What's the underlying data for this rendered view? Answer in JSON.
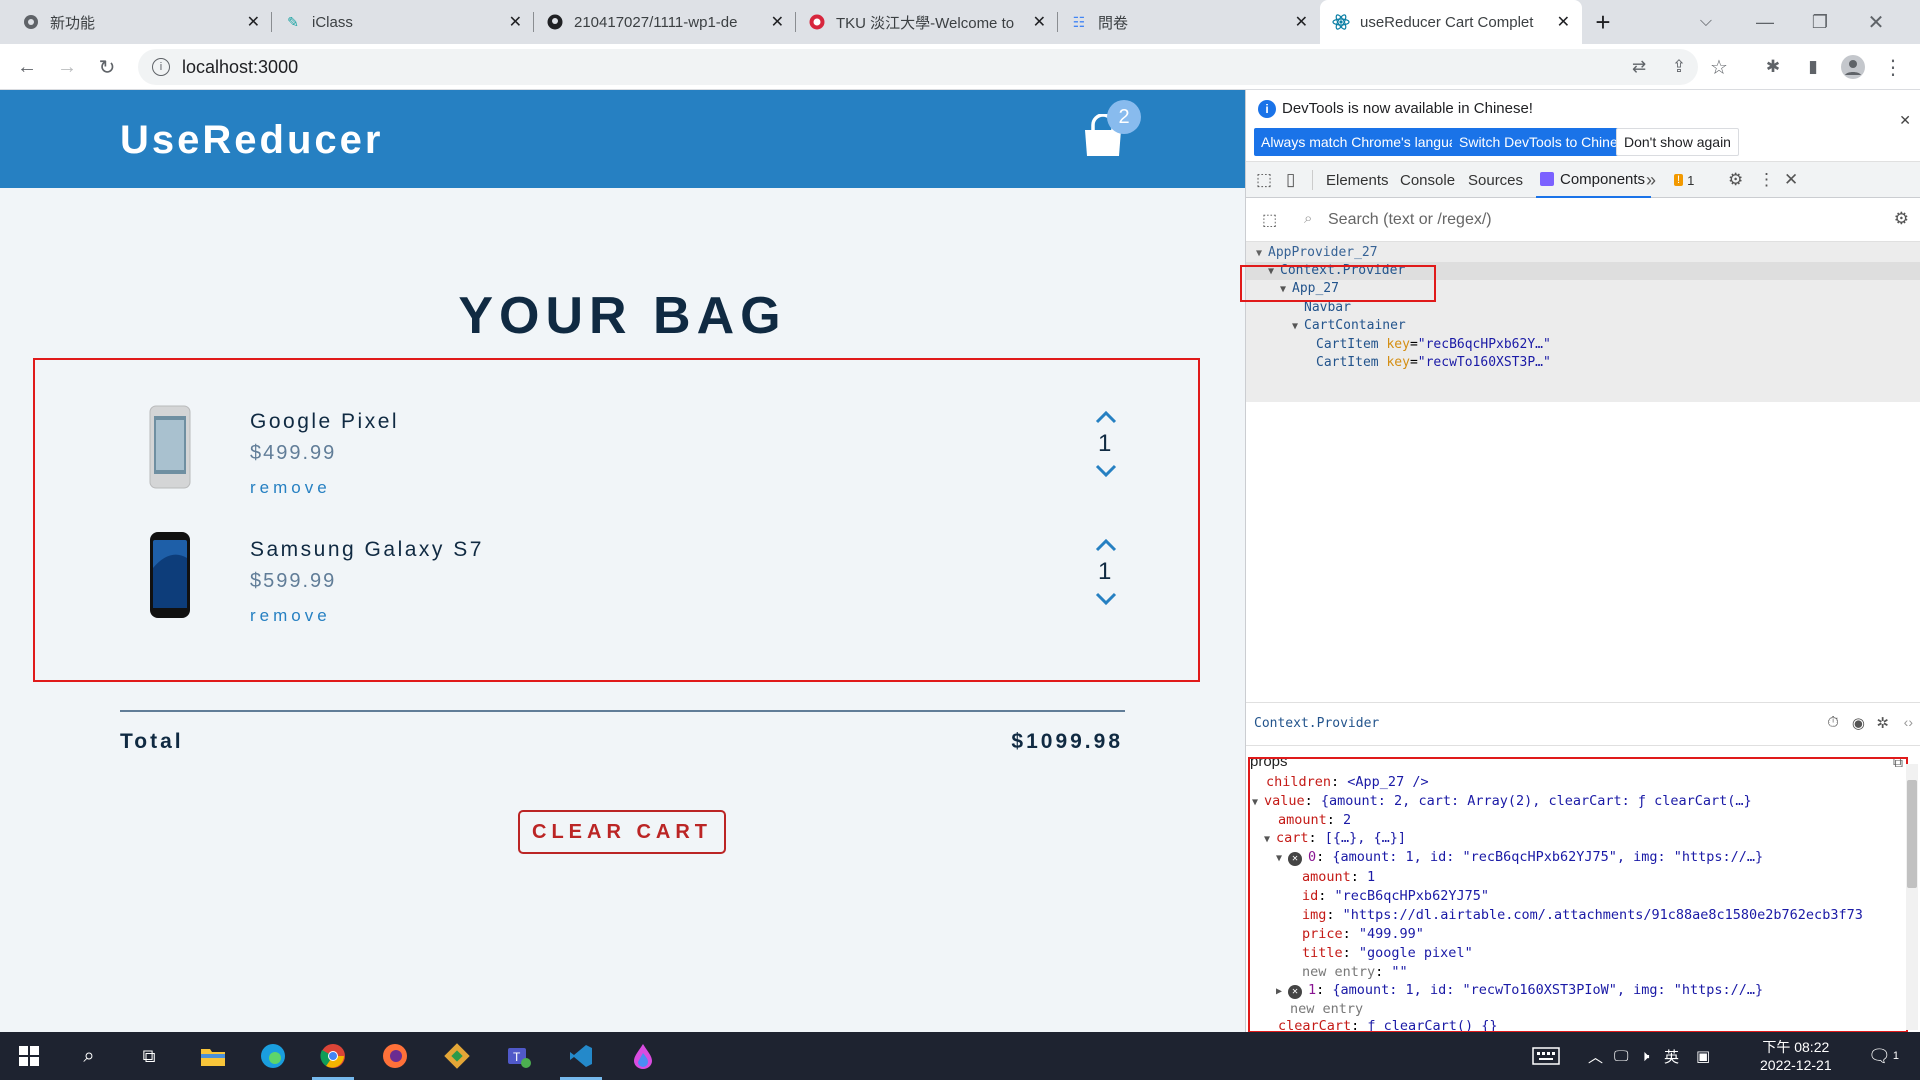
{
  "tabs": [
    {
      "title": "新功能",
      "icon": "chrome-icon"
    },
    {
      "title": "iClass",
      "icon": "iclass-icon"
    },
    {
      "title": "210417027/1111-wp1-de",
      "icon": "github-icon"
    },
    {
      "title": "TKU 淡江大學-Welcome to",
      "icon": "tku-icon"
    },
    {
      "title": "問卷",
      "icon": "survey-icon"
    },
    {
      "title": "useReducer Cart Complet",
      "icon": "react-icon"
    }
  ],
  "address": "localhost:3000",
  "app": {
    "brand": "UseReducer",
    "cart_count": "2",
    "heading": "YOUR BAG",
    "items": [
      {
        "name": "Google Pixel",
        "price": "$499.99",
        "remove": "remove",
        "amount": "1"
      },
      {
        "name": "Samsung Galaxy S7",
        "price": "$599.99",
        "remove": "remove",
        "amount": "1"
      }
    ],
    "total_label": "Total",
    "total_value": "$1099.98",
    "clear_label": "CLEAR CART"
  },
  "devtools": {
    "info_text": "DevTools is now available in Chinese!",
    "btn_match": "Always match Chrome's language",
    "btn_switch": "Switch DevTools to Chinese",
    "btn_dont": "Don't show again",
    "tabs": [
      "Elements",
      "Console",
      "Sources",
      "Components"
    ],
    "warn_count": "1",
    "search_placeholder": "Search (text or /regex/)",
    "tree": {
      "root": "AppProvider_27",
      "provider": "Context.Provider",
      "app": "App_27",
      "navbar": "Navbar",
      "container": "CartContainer",
      "item": "CartItem",
      "key_attr": "key",
      "key1": "\"recB6qcHPxb62Y…\"",
      "key2": "\"recwTo160XST3P…\""
    },
    "selected": "Context.Provider",
    "props_title": "props",
    "props": {
      "children_key": "children",
      "children_val": "<App_27 />",
      "value_key": "value",
      "value_val": "{amount: 2, cart: Array(2), clearCart: ƒ clearCart(…}",
      "amount_key": "amount",
      "amount_val": "2",
      "cart_key": "cart",
      "cart_val": "[{…}, {…}]",
      "item0_key": "0",
      "item0_val": "{amount: 1, id: \"recB6qcHPxb62YJ75\", img: \"https://…}",
      "i_amount_key": "amount",
      "i_amount_val": "1",
      "i_id_key": "id",
      "i_id_val": "\"recB6qcHPxb62YJ75\"",
      "i_img_key": "img",
      "i_img_val": "\"https://dl.airtable.com/.attachments/91c88ae8c1580e2b762ecb3f73",
      "i_price_key": "price",
      "i_price_val": "\"499.99\"",
      "i_title_key": "title",
      "i_title_val": "\"google pixel\"",
      "new_entry_key": "new entry",
      "new_entry_val": "\"\"",
      "item1_key": "1",
      "item1_val": "{amount: 1, id: \"recwTo160XST3PIoW\", img: \"https://…}",
      "new_entry2": "new entry",
      "clear_key": "clearCart",
      "clear_val": "ƒ clearCart() {}"
    }
  },
  "taskbar": {
    "ime": "英",
    "period": "下午 08:22",
    "date": "2022-12-21",
    "notif": "1"
  },
  "colors": {
    "nav": "#2680c2",
    "heading": "#102a42",
    "clear": "#bb2525",
    "highlight": "#e01a1a"
  }
}
